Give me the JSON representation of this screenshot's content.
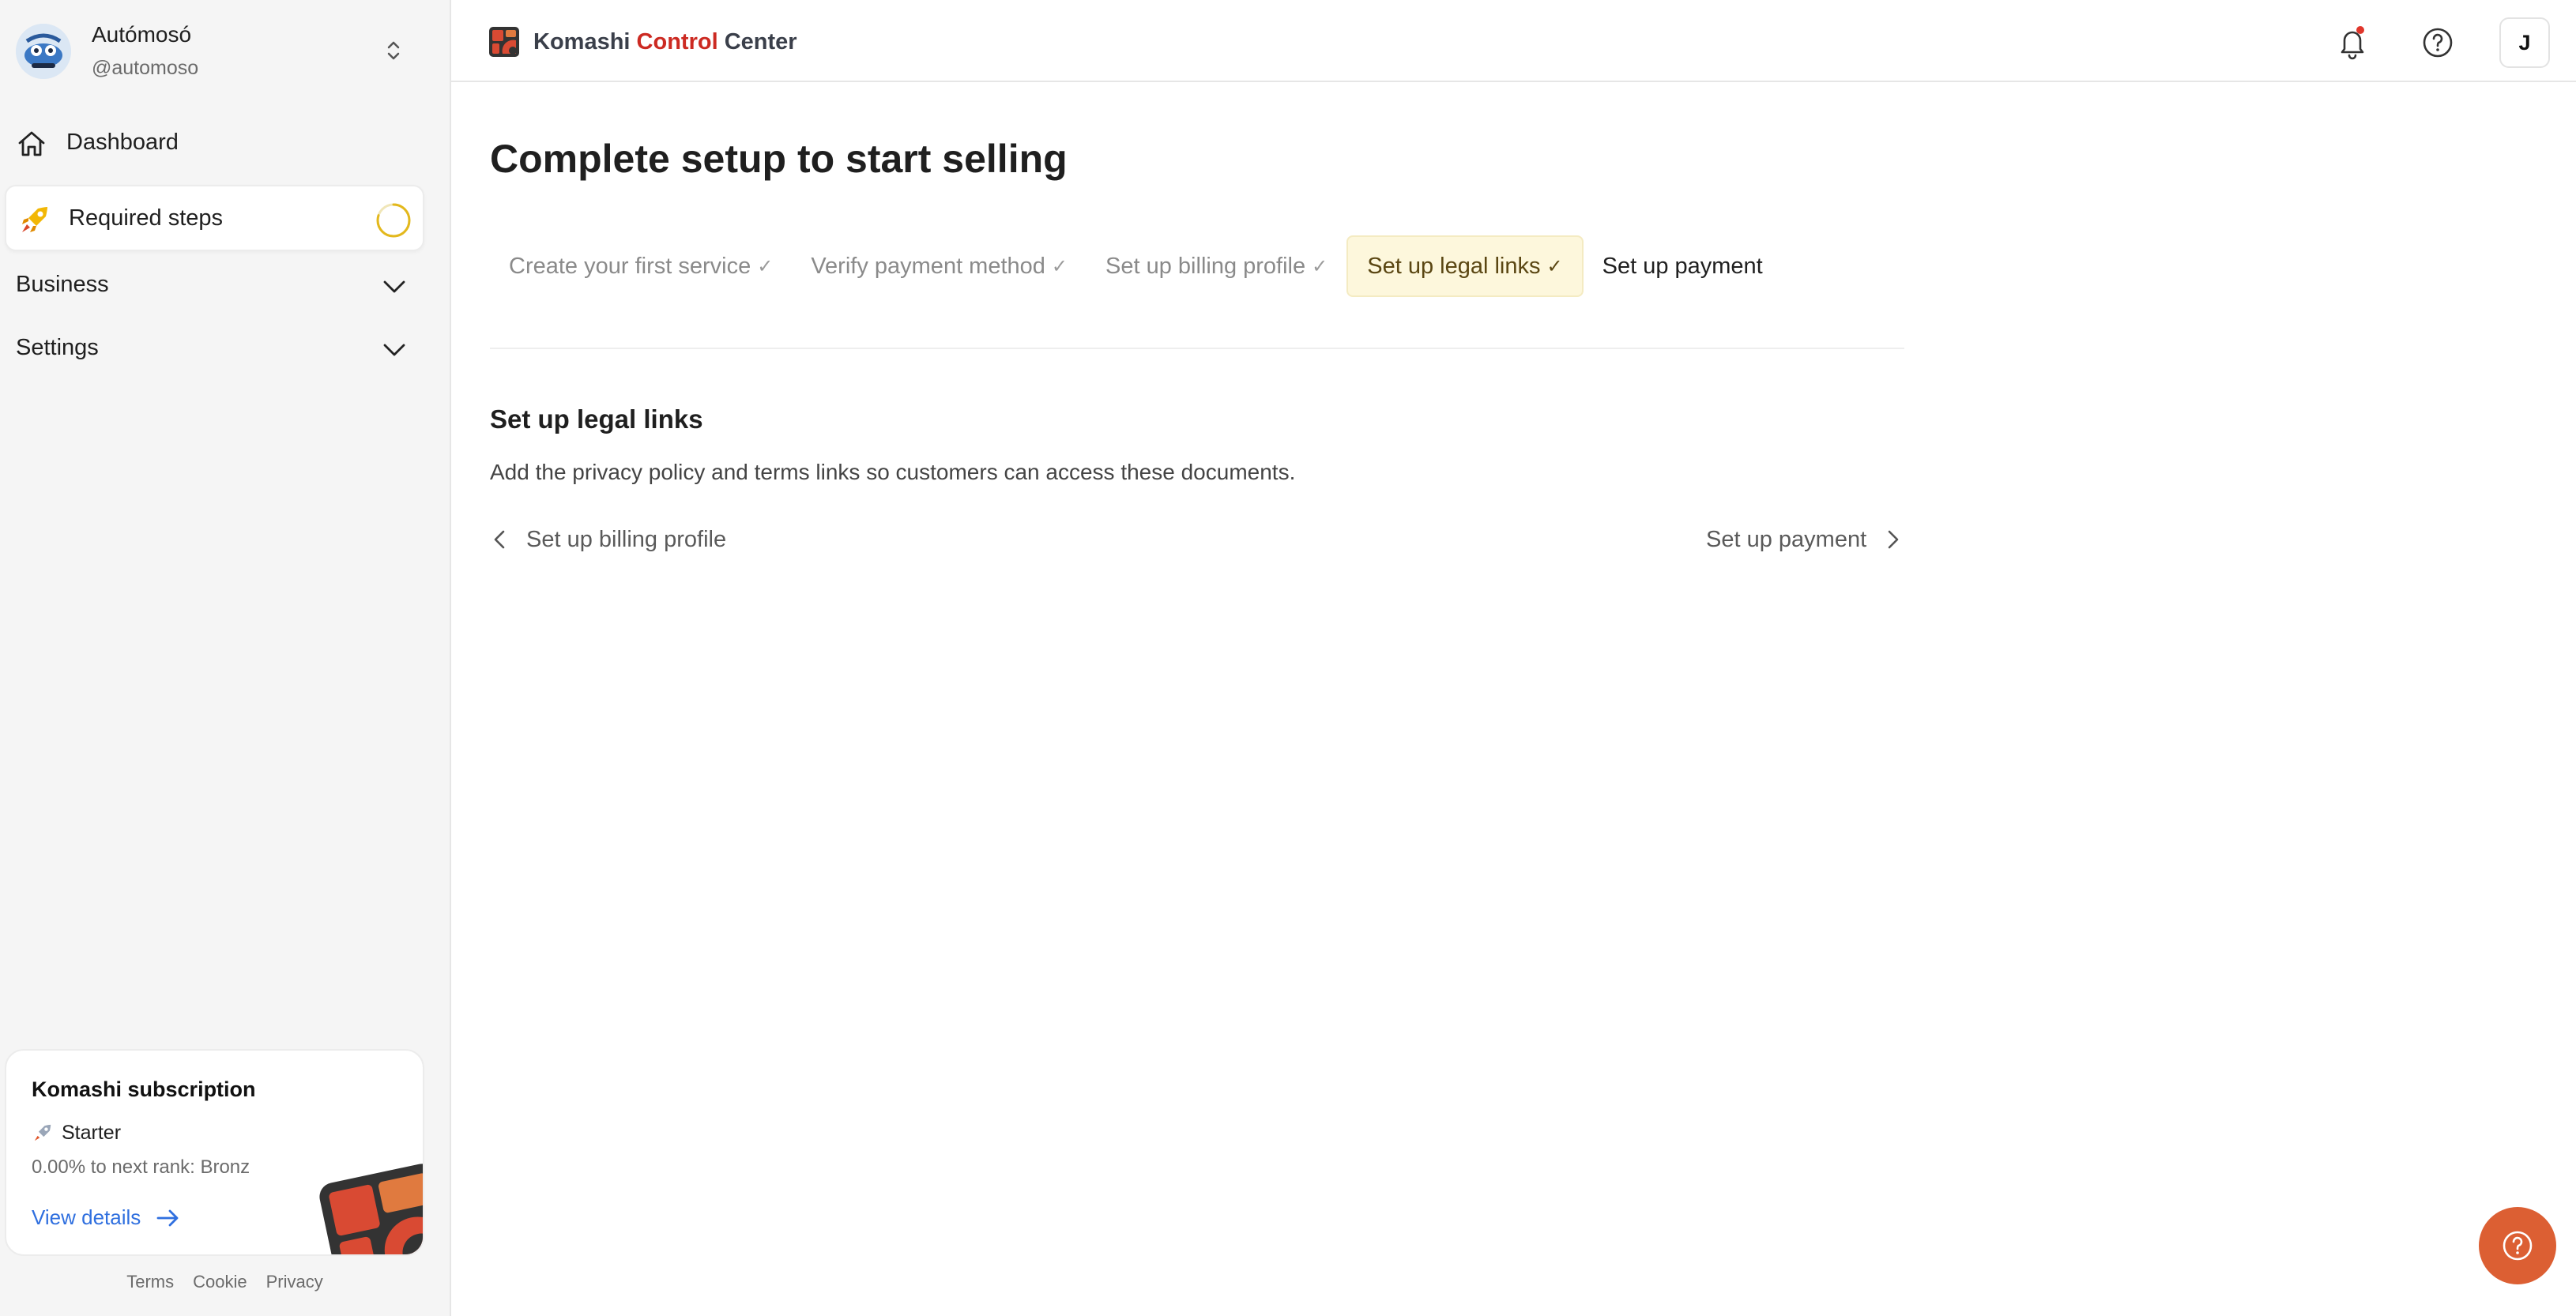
{
  "account": {
    "name": "Autómosó",
    "handle": "@automoso"
  },
  "sidebar": {
    "dashboard_label": "Dashboard",
    "required_steps_label": "Required steps",
    "required_steps_progress": 0.8,
    "business_label": "Business",
    "settings_label": "Settings"
  },
  "subscription": {
    "title": "Komashi subscription",
    "plan": "Starter",
    "rank_text": "0.00% to next rank: Bronz",
    "details_label": "View details"
  },
  "footer": {
    "terms": "Terms",
    "cookie": "Cookie",
    "privacy": "Privacy"
  },
  "header": {
    "brand_part1": "Komashi",
    "brand_part2": "Control",
    "brand_part3": "Center",
    "avatar_initial": "J",
    "notification_dot_color": "#e0362b"
  },
  "main": {
    "title": "Complete setup to start selling",
    "steps": [
      {
        "label": "Create your first service",
        "check": "✓",
        "state": "done"
      },
      {
        "label": "Verify payment method",
        "check": "✓",
        "state": "done"
      },
      {
        "label": "Set up billing profile",
        "check": "✓",
        "state": "done"
      },
      {
        "label": "Set up legal links",
        "check": "✓",
        "state": "active"
      },
      {
        "label": "Set up payment",
        "check": "",
        "state": "upcoming"
      }
    ],
    "section_title": "Set up legal links",
    "section_desc": "Add the privacy policy and terms links so customers can access these documents.",
    "prev_label": "Set up billing profile",
    "next_label": "Set up payment"
  },
  "colors": {
    "accent_active_bg": "#fdf7dc",
    "brand_red": "#cc2a22",
    "fab": "#dc5f33",
    "link": "#2f6fdf",
    "ring": "#e3b81c"
  }
}
